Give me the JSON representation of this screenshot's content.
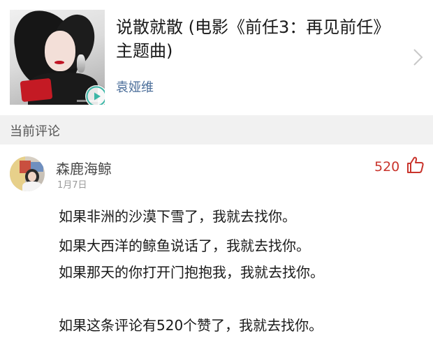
{
  "song": {
    "title": "说散就散 (电影《前任3：再见前任》主题曲)",
    "artist": "袁娅维"
  },
  "section": {
    "label": "当前评论"
  },
  "comment": {
    "username": "森鹿海鲸",
    "date": "1月7日",
    "likes": "520",
    "lines": [
      "如果非洲的沙漠下雪了，我就去找你。",
      "如果大西洋的鲸鱼说话了，我就去找你。",
      "如果那天的你打开门抱抱我，我就去找你。",
      "如果这条评论有520个赞了，我就去找你。"
    ]
  },
  "icons": {
    "play": "play-icon",
    "chevron": "chevron-right-icon",
    "like": "thumbs-up-icon"
  },
  "colors": {
    "artist": "#4a6d99",
    "likes": "#c9342c",
    "section_bg": "#f1f1f1",
    "play_accent": "#3bb6a6"
  }
}
